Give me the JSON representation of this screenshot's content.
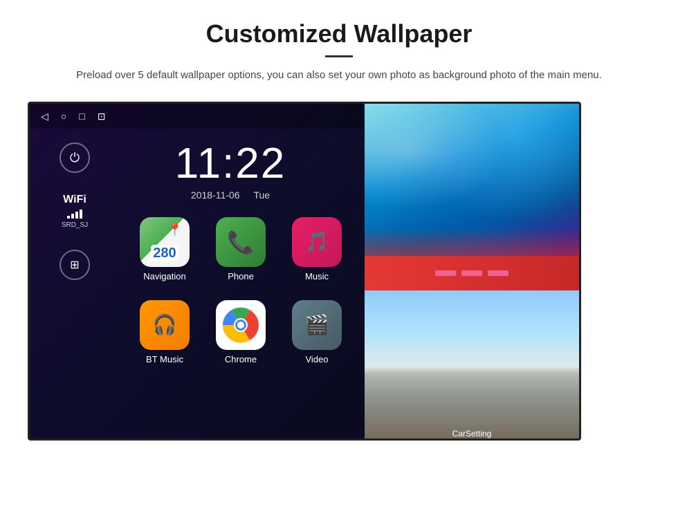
{
  "header": {
    "title": "Customized Wallpaper",
    "description": "Preload over 5 default wallpaper options, you can also set your own photo as background photo of the main menu."
  },
  "statusBar": {
    "time": "11:22",
    "navButtons": [
      "◁",
      "○",
      "□",
      "⊡"
    ]
  },
  "clock": {
    "time": "11:22",
    "date": "2018-11-06",
    "day": "Tue"
  },
  "wifi": {
    "label": "WiFi",
    "network": "SRD_SJ"
  },
  "apps": [
    {
      "name": "Navigation",
      "type": "navigation"
    },
    {
      "name": "Phone",
      "type": "phone"
    },
    {
      "name": "Music",
      "type": "music"
    },
    {
      "name": "BT Music",
      "type": "btmusic"
    },
    {
      "name": "Chrome",
      "type": "chrome"
    },
    {
      "name": "Video",
      "type": "video"
    }
  ],
  "carSetting": {
    "label": "CarSetting"
  },
  "wallpapers": {
    "title": "Customized Wallpaper"
  }
}
